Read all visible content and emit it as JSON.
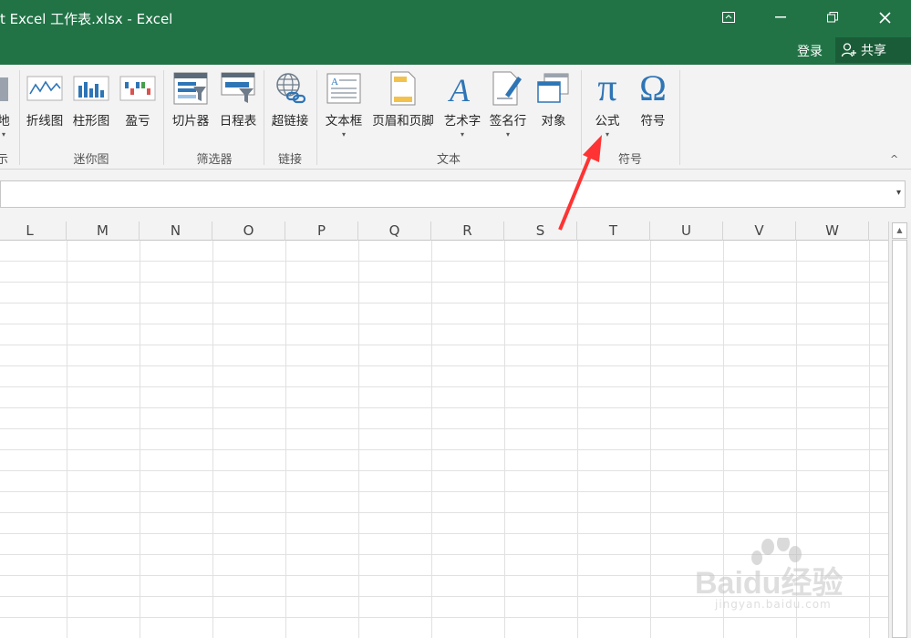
{
  "window": {
    "title": "t Excel 工作表.xlsx - Excel",
    "controls": {
      "ribbon_display": "⊡",
      "minimize": "—",
      "restore": "❐",
      "close": "✕"
    },
    "login": "登录",
    "share": "共享"
  },
  "ribbon": {
    "groups": [
      {
        "label": "示",
        "buttons": [
          {
            "label": "地",
            "caret": "▾"
          }
        ]
      },
      {
        "label": "迷你图",
        "buttons": [
          {
            "label": "折线图"
          },
          {
            "label": "柱形图"
          },
          {
            "label": "盈亏"
          }
        ]
      },
      {
        "label": "筛选器",
        "buttons": [
          {
            "label": "切片器"
          },
          {
            "label": "日程表"
          }
        ]
      },
      {
        "label": "链接",
        "buttons": [
          {
            "label": "超链接"
          }
        ]
      },
      {
        "label": "文本",
        "buttons": [
          {
            "label": "文本框",
            "caret": "▾"
          },
          {
            "label": "页眉和页脚"
          },
          {
            "label": "艺术字",
            "caret": "▾"
          },
          {
            "label": "签名行",
            "caret": "▾"
          },
          {
            "label": "对象"
          }
        ]
      },
      {
        "label": "符号",
        "buttons": [
          {
            "label": "公式",
            "caret": "▾",
            "glyph": "π"
          },
          {
            "label": "符号",
            "glyph": "Ω"
          }
        ]
      }
    ],
    "collapse": "^"
  },
  "formula_bar": {
    "value": "",
    "expand": "▾"
  },
  "sheet": {
    "columns": [
      "L",
      "M",
      "N",
      "O",
      "P",
      "Q",
      "R",
      "S",
      "T",
      "U",
      "V",
      "W"
    ]
  },
  "scrollbar": {
    "up": "▲"
  },
  "watermark": {
    "brand": "Baidu经验",
    "url": "jingyan.baidu.com"
  },
  "colors": {
    "title_bar": "#217346",
    "accent_icon": "#2e75b6",
    "annotation": "#ff3333"
  },
  "icons": {
    "ribbon_display": "ribbon-display-icon",
    "formula": "pi-icon",
    "symbol": "omega-icon",
    "share": "share-person-icon"
  }
}
